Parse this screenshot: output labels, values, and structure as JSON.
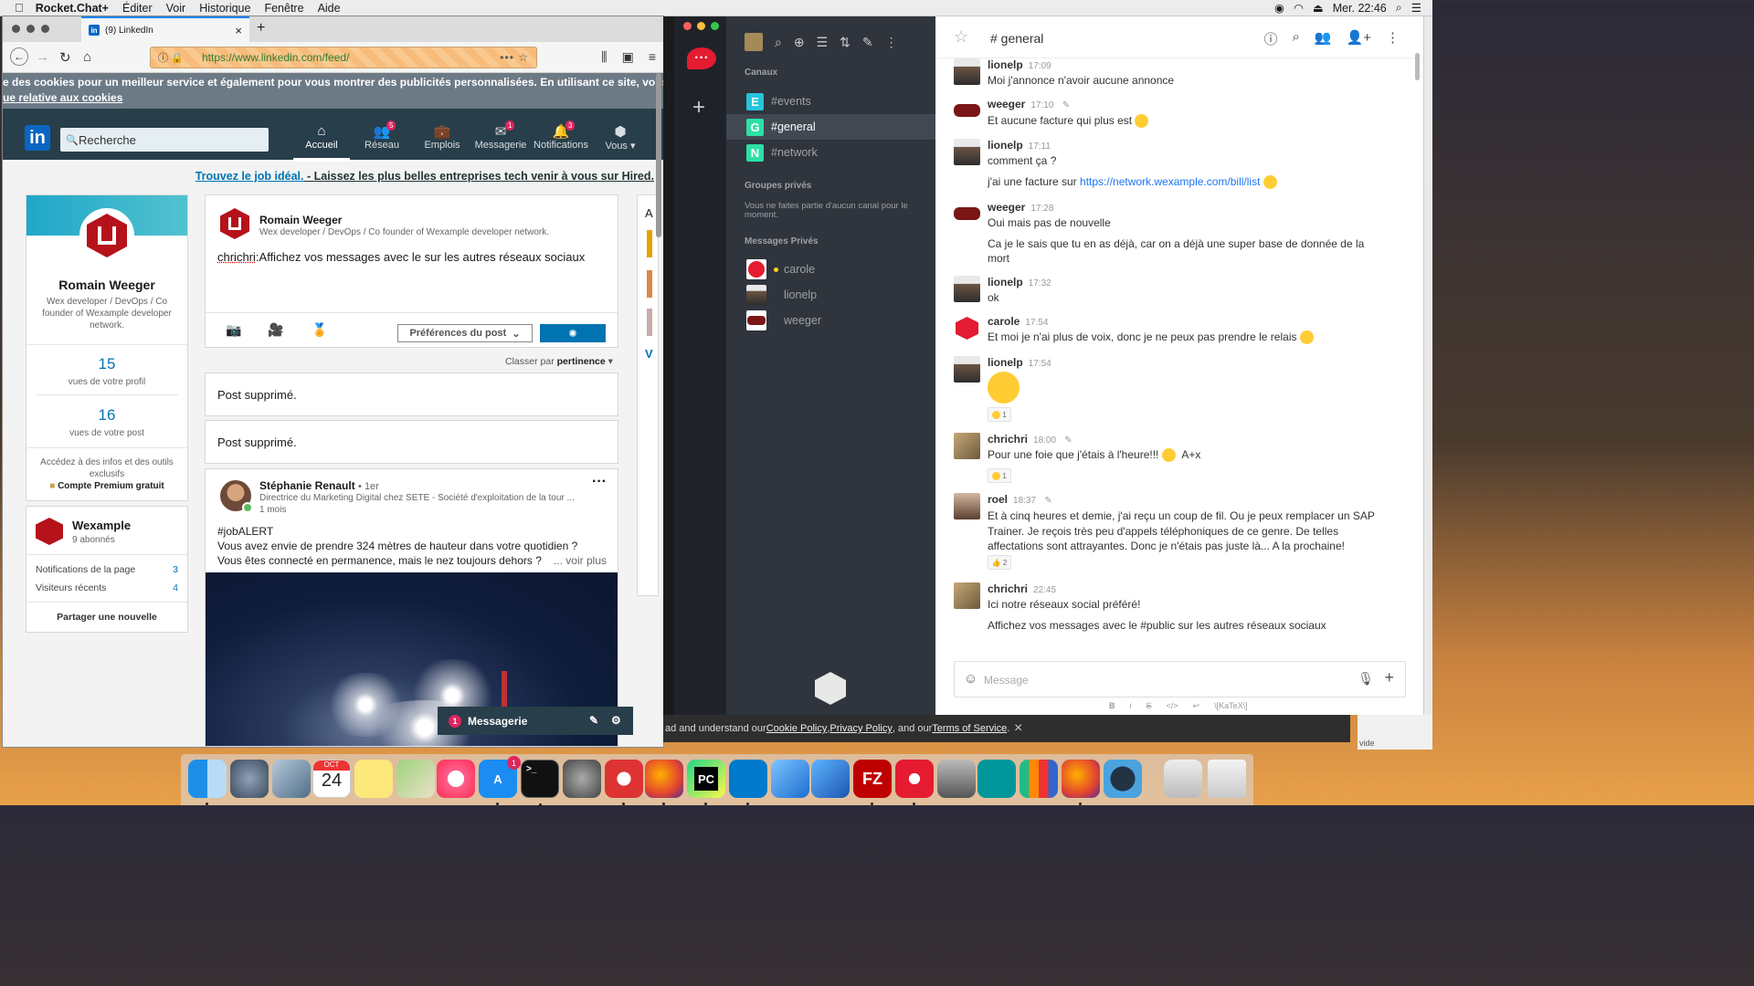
{
  "menubar": {
    "app": "Rocket.Chat+",
    "items": [
      "Éditer",
      "Voir",
      "Historique",
      "Fenêtre",
      "Aide"
    ],
    "clock": "Mer. 22:46"
  },
  "firefox": {
    "tab_title": "(9) LinkedIn",
    "url": "https://www.linkedin.com/feed/"
  },
  "linkedin": {
    "cookie_text": "e des cookies pour un meilleur service et également pour vous montrer des publicités personnalisées. En utilisant ce site, vous accepte",
    "cookie_link": "ue relative aux cookies",
    "search_placeholder": "Recherche",
    "nav": [
      {
        "label": "Accueil",
        "badge": ""
      },
      {
        "label": "Réseau",
        "badge": "5"
      },
      {
        "label": "Emplois",
        "badge": ""
      },
      {
        "label": "Messagerie",
        "badge": "1"
      },
      {
        "label": "Notifications",
        "badge": "3"
      },
      {
        "label": "Vous",
        "badge": ""
      }
    ],
    "hired_link": "Trouvez le job idéal.",
    "hired_text": " - Laissez les plus belles entreprises tech venir à vous sur Hired.",
    "profile": {
      "name": "Romain Weeger",
      "headline": "Wex developer / DevOps / Co founder of Wexample developer network.",
      "views_profile": "15",
      "views_profile_label": "vues de votre profil",
      "views_post": "16",
      "views_post_label": "vues de votre post",
      "premium_text": "Accédez à des infos et des outils exclusifs",
      "premium_link": "Compte Premium gratuit"
    },
    "company": {
      "name": "Wexample",
      "followers": "9 abonnés",
      "notif_label": "Notifications de la page",
      "notif_count": "3",
      "visitors_label": "Visiteurs récents",
      "visitors_count": "4",
      "share_label": "Partager une nouvelle"
    },
    "share": {
      "name": "Romain Weeger",
      "headline": "Wex developer / DevOps / Co founder of Wexample developer network.",
      "mention": "chrichri",
      "text": ":Affichez vos messages avec le  sur les autres réseaux sociaux",
      "pref_label": "Préférences du post"
    },
    "sort": {
      "prefix": "Classer par ",
      "value": "pertinence"
    },
    "deleted": [
      "Post supprimé.",
      "Post supprimé."
    ],
    "post": {
      "author": "Stéphanie Renault",
      "degree": "• 1er",
      "headline": "Directrice du Marketing Digital chez SETE - Société d'exploitation de la tour ...",
      "time": "1 mois",
      "line1": "#jobALERT",
      "line2": "Vous avez envie de prendre 324 mètres de hauteur dans votre quotidien ?",
      "line3": "Vous êtes connecté en permanence, mais le nez toujours dehors ?",
      "more": "... voir plus"
    },
    "rightcol": {
      "letter": "A",
      "link": "V"
    },
    "messaging": {
      "badge": "1",
      "label": "Messagerie"
    }
  },
  "rocketchat": {
    "sidebar": {
      "channels_title": "Canaux",
      "channels": [
        {
          "letter": "E",
          "name": "events",
          "color": "#26c5da"
        },
        {
          "letter": "G",
          "name": "general",
          "color": "#2de0a5"
        },
        {
          "letter": "N",
          "name": "network",
          "color": "#2de0a5"
        }
      ],
      "private_title": "Groupes privés",
      "private_empty": "Vous ne faites partie d'aucun canal pour le moment.",
      "dm_title": "Messages Privés",
      "dms": [
        {
          "name": "carole",
          "status": "#ffd21f"
        },
        {
          "name": "lionelp",
          "status": "#2f343d"
        },
        {
          "name": "weeger",
          "status": "#2f343d"
        }
      ]
    },
    "channel": {
      "title": "# general"
    },
    "messages": [
      {
        "user": "lionelp",
        "time": "17:09",
        "text": "Moi j'annonce n'avoir aucune annonce"
      },
      {
        "user": "weeger",
        "time": "17:10",
        "text": "Et aucune facture qui plus est"
      },
      {
        "user": "lionelp",
        "time": "17:11",
        "text": "comment ça ?",
        "text2_prefix": "j'ai une facture sur ",
        "link": "https://network.wexample.com/bill/list"
      },
      {
        "user": "weeger",
        "time": "17:28",
        "text": "Oui mais pas de nouvelle",
        "text2": "Ca je le sais que tu en as déjà, car on a déjà une super base de donnée de la mort"
      },
      {
        "user": "lionelp",
        "time": "17:32",
        "text": "ok"
      },
      {
        "user": "carole",
        "time": "17:54",
        "text": "Et moi je n'ai plus de voix, donc je ne peux pas prendre le relais"
      },
      {
        "user": "lionelp",
        "time": "17:54",
        "reaction": "1"
      },
      {
        "user": "chrichri",
        "time": "18:00",
        "text": "Pour une foie que j'étais à l'heure!!!",
        "text_suffix": "A+x",
        "reaction": "1"
      },
      {
        "user": "roel",
        "time": "18:37",
        "text": "Et à cinq heures et demie, j'ai reçu un coup de fil. Ou je peux remplacer un SAP Trainer. Je reçois très peu d'appels téléphoniques de ce genre. De telles affectations sont attrayantes. Donc je n'étais pas juste là... A la prochaine!",
        "reaction": "2"
      },
      {
        "user": "chrichri",
        "time": "22:45",
        "text": "Ici notre réseaux social préféré!",
        "text2": "Affichez vos messages avec le #public sur les autres réseaux sociaux"
      }
    ],
    "composer": {
      "placeholder": "Message",
      "format": [
        "B",
        "i",
        "S",
        "</>",
        "↩",
        "\\[KaTeX\\]"
      ]
    }
  },
  "cookie_bar": {
    "prefix": "ad and understand our ",
    "l1": "Cookie Policy",
    "sep1": ", ",
    "l2": "Privacy Policy",
    "sep2": ", and our ",
    "l3": "Terms of Service",
    "suffix": "."
  },
  "misc": {
    "vide": "vide"
  },
  "dock": {
    "calendar_month": "OCT",
    "calendar_day": "24",
    "appstore_badge": "1",
    "filezilla": "FZ",
    "pycharm": "PC"
  }
}
